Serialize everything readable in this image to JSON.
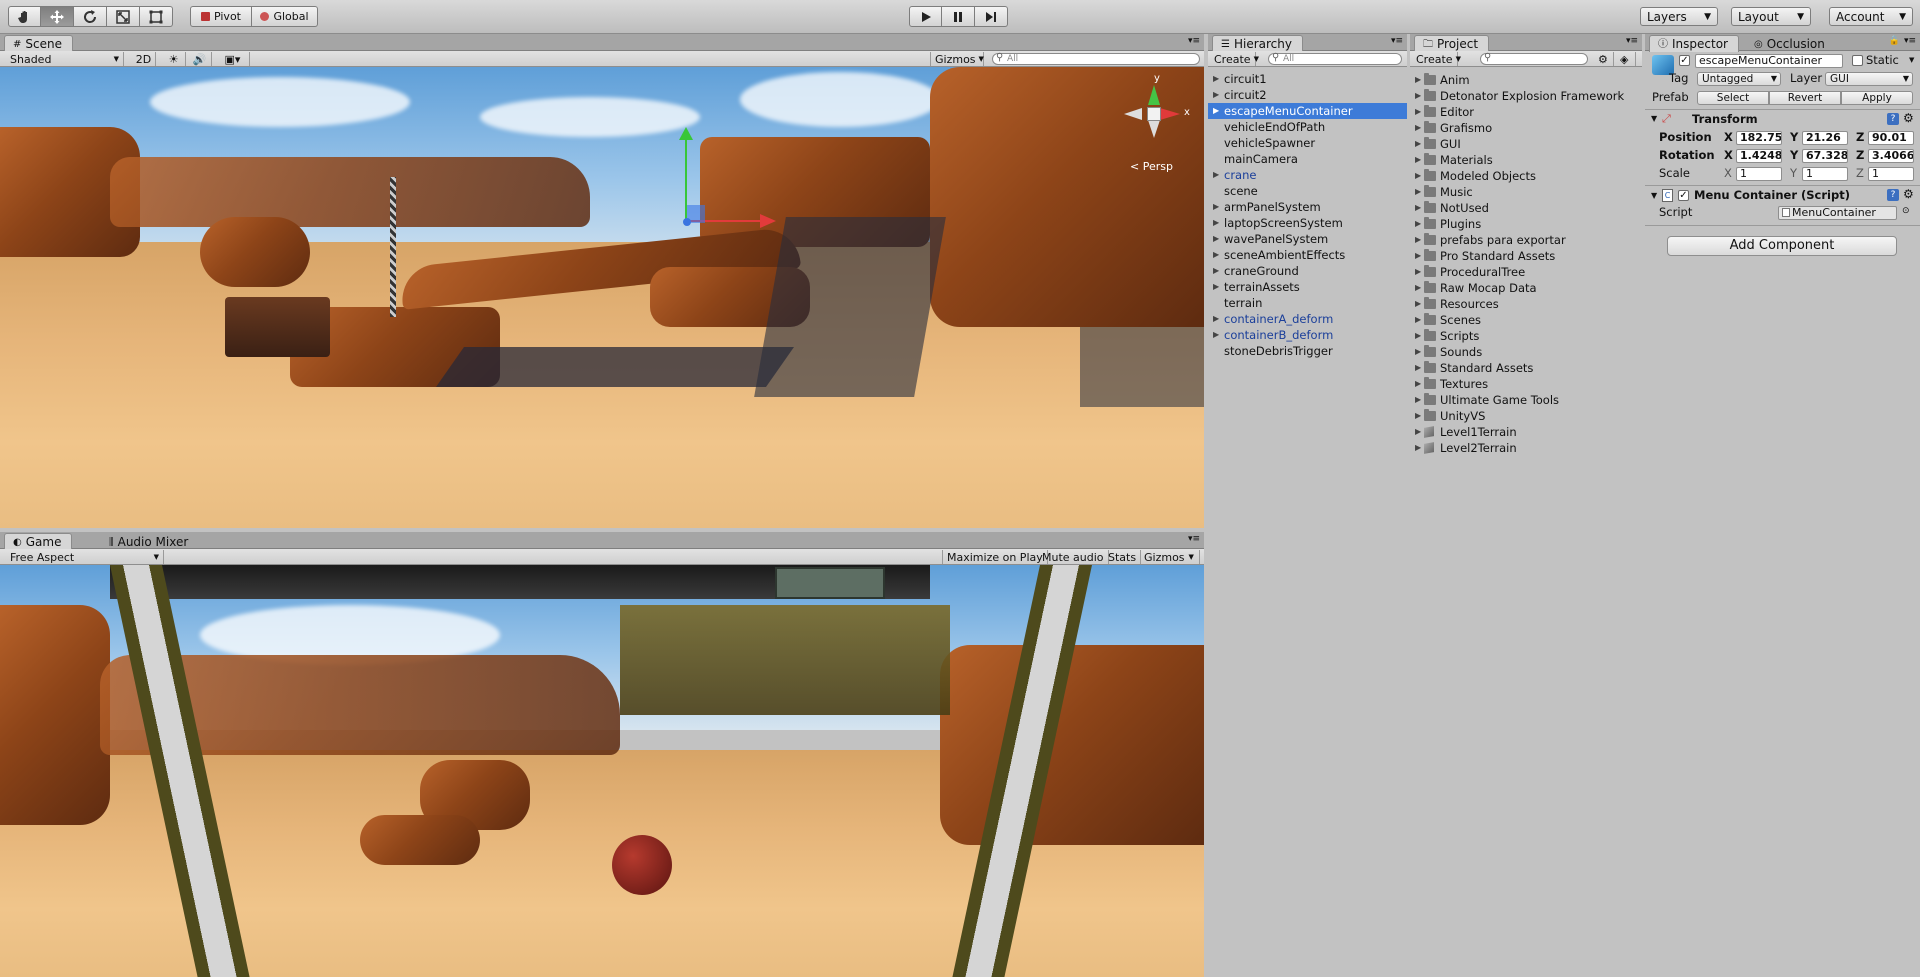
{
  "toolbar": {
    "pivot_label": "Pivot",
    "global_label": "Global",
    "layers_label": "Layers",
    "layout_label": "Layout",
    "account_label": "Account"
  },
  "scene": {
    "tab_label": "Scene",
    "shading_mode": "Shaded",
    "mode_2d": "2D",
    "gizmos_label": "Gizmos",
    "search_placeholder": "All",
    "persp_label": "Persp",
    "gizmo_x": "x",
    "gizmo_y": "y"
  },
  "game": {
    "tab_label": "Game",
    "audio_mixer_tab": "Audio Mixer",
    "aspect": "Free Aspect",
    "maximize_on_play": "Maximize on Play",
    "mute_audio": "Mute audio",
    "stats": "Stats",
    "gizmos": "Gizmos"
  },
  "hierarchy": {
    "tab_label": "Hierarchy",
    "create_label": "Create",
    "search_placeholder": "All",
    "items": [
      {
        "label": "circuit1",
        "expandable": true,
        "prefab": false,
        "selected": false
      },
      {
        "label": "circuit2",
        "expandable": true,
        "prefab": false,
        "selected": false
      },
      {
        "label": "escapeMenuContainer",
        "expandable": true,
        "prefab": true,
        "selected": true
      },
      {
        "label": "vehicleEndOfPath",
        "expandable": false,
        "prefab": false,
        "selected": false
      },
      {
        "label": "vehicleSpawner",
        "expandable": false,
        "prefab": false,
        "selected": false
      },
      {
        "label": "mainCamera",
        "expandable": false,
        "prefab": false,
        "selected": false
      },
      {
        "label": "crane",
        "expandable": true,
        "prefab": true,
        "selected": false
      },
      {
        "label": "scene",
        "expandable": false,
        "prefab": false,
        "selected": false
      },
      {
        "label": "armPanelSystem",
        "expandable": true,
        "prefab": false,
        "selected": false
      },
      {
        "label": "laptopScreenSystem",
        "expandable": true,
        "prefab": false,
        "selected": false
      },
      {
        "label": "wavePanelSystem",
        "expandable": true,
        "prefab": false,
        "selected": false
      },
      {
        "label": "sceneAmbientEffects",
        "expandable": true,
        "prefab": false,
        "selected": false
      },
      {
        "label": "craneGround",
        "expandable": true,
        "prefab": false,
        "selected": false
      },
      {
        "label": "terrainAssets",
        "expandable": true,
        "prefab": false,
        "selected": false
      },
      {
        "label": "terrain",
        "expandable": false,
        "prefab": false,
        "selected": false
      },
      {
        "label": "containerA_deform",
        "expandable": true,
        "prefab": true,
        "selected": false
      },
      {
        "label": "containerB_deform",
        "expandable": true,
        "prefab": true,
        "selected": false
      },
      {
        "label": "stoneDebrisTrigger",
        "expandable": false,
        "prefab": false,
        "selected": false
      }
    ]
  },
  "project": {
    "tab_label": "Project",
    "create_label": "Create",
    "items": [
      {
        "label": "Anim",
        "kind": "folder"
      },
      {
        "label": "Detonator Explosion Framework",
        "kind": "folder"
      },
      {
        "label": "Editor",
        "kind": "folder"
      },
      {
        "label": "Grafismo",
        "kind": "folder"
      },
      {
        "label": "GUI",
        "kind": "folder"
      },
      {
        "label": "Materials",
        "kind": "folder"
      },
      {
        "label": "Modeled Objects",
        "kind": "folder"
      },
      {
        "label": "Music",
        "kind": "folder"
      },
      {
        "label": "NotUsed",
        "kind": "folder"
      },
      {
        "label": "Plugins",
        "kind": "folder"
      },
      {
        "label": "prefabs para exportar",
        "kind": "folder"
      },
      {
        "label": "Pro Standard Assets",
        "kind": "folder"
      },
      {
        "label": "ProceduralTree",
        "kind": "folder"
      },
      {
        "label": "Raw Mocap Data",
        "kind": "folder"
      },
      {
        "label": "Resources",
        "kind": "folder"
      },
      {
        "label": "Scenes",
        "kind": "folder"
      },
      {
        "label": "Scripts",
        "kind": "folder"
      },
      {
        "label": "Sounds",
        "kind": "folder"
      },
      {
        "label": "Standard Assets",
        "kind": "folder"
      },
      {
        "label": "Textures",
        "kind": "folder"
      },
      {
        "label": "Ultimate Game Tools",
        "kind": "folder"
      },
      {
        "label": "UnityVS",
        "kind": "folder"
      },
      {
        "label": "Level1Terrain",
        "kind": "asset"
      },
      {
        "label": "Level2Terrain",
        "kind": "asset"
      }
    ]
  },
  "inspector": {
    "tab_label": "Inspector",
    "occlusion_tab": "Occlusion",
    "object_name": "escapeMenuContainer",
    "static_label": "Static",
    "tag_label": "Tag",
    "tag_value": "Untagged",
    "layer_label": "Layer",
    "layer_value": "GUI",
    "prefab_label": "Prefab",
    "select_label": "Select",
    "revert_label": "Revert",
    "apply_label": "Apply",
    "transform": {
      "title": "Transform",
      "position_label": "Position",
      "rotation_label": "Rotation",
      "scale_label": "Scale",
      "position": {
        "x": "182.75",
        "y": "21.26",
        "z": "90.01"
      },
      "rotation": {
        "x": "1.4248",
        "y": "67.328",
        "z": "3.4066"
      },
      "scale": {
        "x": "1",
        "y": "1",
        "z": "1"
      }
    },
    "component": {
      "title": "Menu Container (Script)",
      "script_label": "Script",
      "script_value": "MenuContainer"
    },
    "add_component_label": "Add Component",
    "axis_x": "X",
    "axis_y": "Y",
    "axis_z": "Z"
  }
}
